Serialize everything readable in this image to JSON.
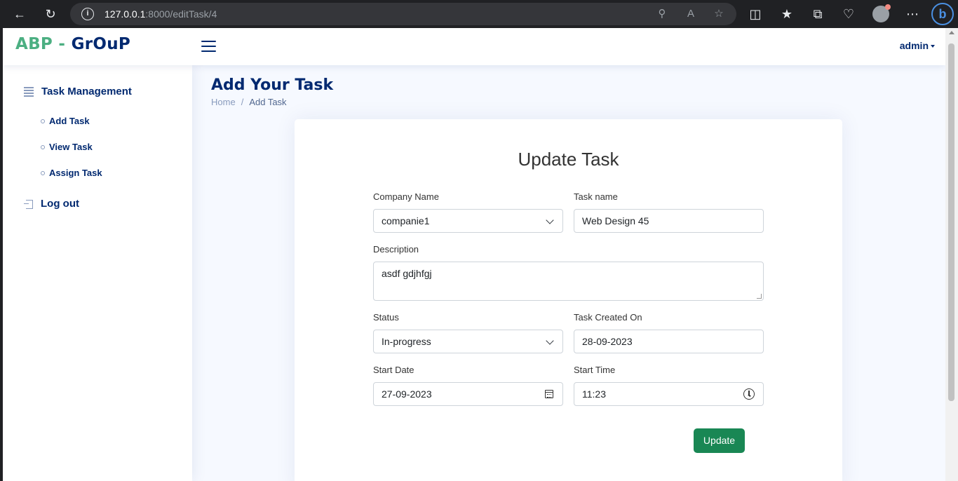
{
  "browser": {
    "url_host": "127.0.0.1",
    "url_path": ":8000/editTask/4",
    "icons": [
      "back-icon",
      "reload-icon",
      "info-icon",
      "zoom-icon",
      "read-aloud-icon",
      "favorite-icon",
      "split-screen-icon",
      "favorites-icon",
      "collections-icon",
      "health-icon",
      "profile-icon",
      "more-icon",
      "bing-icon"
    ]
  },
  "header": {
    "logo_a": "ABP -",
    "logo_b": "GrOuP",
    "user": "admin"
  },
  "sidebar": {
    "section": "Task Management",
    "items": [
      {
        "label": "Add Task"
      },
      {
        "label": "View Task"
      },
      {
        "label": "Assign Task"
      }
    ],
    "logout": "Log out"
  },
  "main": {
    "title": "Add Your Task",
    "breadcrumb_home": "Home",
    "breadcrumb_sep": "/",
    "breadcrumb_current": "Add Task"
  },
  "form": {
    "title": "Update Task",
    "company_label": "Company Name",
    "company_value": "companie1",
    "taskname_label": "Task name",
    "taskname_value": "Web Design 45",
    "description_label": "Description",
    "description_value": "asdf gdjhfgj",
    "status_label": "Status",
    "status_value": "In-progress",
    "created_label": "Task Created On",
    "created_value": "28-09-2023",
    "start_date_label": "Start Date",
    "start_date_value": "27-09-2023",
    "start_time_label": "Start Time",
    "start_time_value": "11:23",
    "submit_label": "Update"
  },
  "colors": {
    "brand_green": "#4caf82",
    "brand_navy": "#012970",
    "button_green": "#198754",
    "page_bg": "#f6f9ff"
  }
}
